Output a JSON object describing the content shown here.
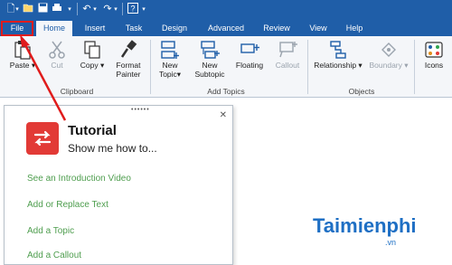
{
  "tabs": {
    "file": "File",
    "home": "Home",
    "insert": "Insert",
    "task": "Task",
    "design": "Design",
    "advanced": "Advanced",
    "review": "Review",
    "view": "View",
    "help": "Help"
  },
  "ribbon": {
    "paste": "Paste",
    "cut": "Cut",
    "copy": "Copy",
    "format_painter_line1": "Format",
    "format_painter_line2": "Painter",
    "new_topic_line1": "New",
    "new_topic_line2": "Topic",
    "new_subtopic_line1": "New",
    "new_subtopic_line2": "Subtopic",
    "floating": "Floating",
    "callout": "Callout",
    "relationship": "Relationship",
    "boundary": "Boundary",
    "icons": "Icons",
    "group_clipboard": "Clipboard",
    "group_add_topics": "Add Topics",
    "group_objects": "Objects"
  },
  "tutorial": {
    "title": "Tutorial",
    "subtitle": "Show me how to...",
    "links": [
      "See an Introduction Video",
      "Add or Replace Text",
      "Add a Topic",
      "Add a Callout"
    ]
  },
  "watermark": {
    "brand": "Taimienphi",
    "domain": ".vn"
  },
  "colors": {
    "title_bar": "#1f5ea8",
    "accent_red": "#e01c1c",
    "link_green": "#4f9e4f",
    "tutorial_icon": "#e23a36"
  },
  "icons": [
    "new-file-icon",
    "open-icon",
    "save-icon",
    "print-icon",
    "undo-icon",
    "redo-icon",
    "help-icon",
    "paste-icon",
    "cut-icon",
    "copy-icon",
    "format-painter-icon",
    "new-topic-icon",
    "new-subtopic-icon",
    "floating-icon",
    "callout-icon",
    "relationship-icon",
    "boundary-icon",
    "icons-icon",
    "close-icon",
    "tutorial-icon"
  ]
}
